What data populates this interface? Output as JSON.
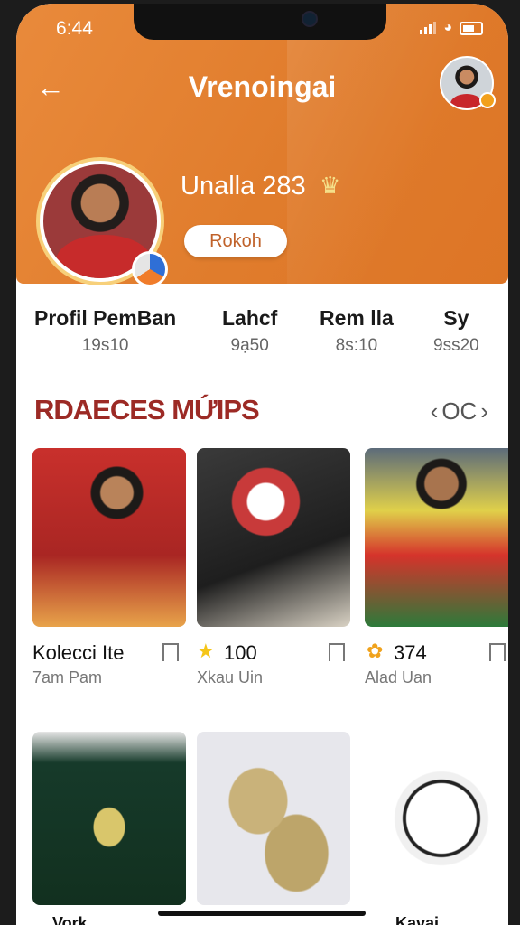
{
  "status_bar": {
    "time": "6:44"
  },
  "header": {
    "title": "Vrenoingai",
    "username": "Unalla 283",
    "role": "Rokoh",
    "badge_icon": "crest-badge-icon"
  },
  "stats": [
    {
      "label": "Profil PemBan",
      "value": "19s10"
    },
    {
      "label": "Lahcf",
      "value": "9ạ50"
    },
    {
      "label": "Rem lla",
      "value": "8s:10"
    },
    {
      "label": "Sy",
      "value": "9ss20"
    }
  ],
  "section": {
    "title": "RDAECES MỨIPS",
    "nav_text": "OC"
  },
  "cards": [
    {
      "title": "Kolecci Ite",
      "sub": "7am Pam",
      "icon": "bookmark-icon",
      "colors": [
        "#c9302c",
        "#e8a34a"
      ]
    },
    {
      "title": "100",
      "sub": "Xkau Uin",
      "icon": "star-icon",
      "colors": [
        "#2a2a2a",
        "#c83a3a"
      ]
    },
    {
      "title": "374",
      "sub": "Alad Uan",
      "icon": "flower-icon",
      "colors": [
        "#2c7a3a",
        "#d5332b"
      ]
    },
    {
      "title": "",
      "sub": "",
      "icon": "hoodie",
      "colors": [
        "#163a2a",
        "#d9c66b"
      ]
    },
    {
      "title": "",
      "sub": "",
      "icon": "sneakers",
      "colors": [
        "#c9b27a",
        "#e7e7ec"
      ]
    },
    {
      "title": "",
      "sub": "",
      "icon": "football",
      "colors": [
        "#ffffff",
        "#222222"
      ]
    }
  ],
  "bottom_labels": [
    "Vork",
    "Kavai"
  ],
  "colors": {
    "header_orange": "#e07c2c",
    "section_red": "#9c2a25"
  }
}
